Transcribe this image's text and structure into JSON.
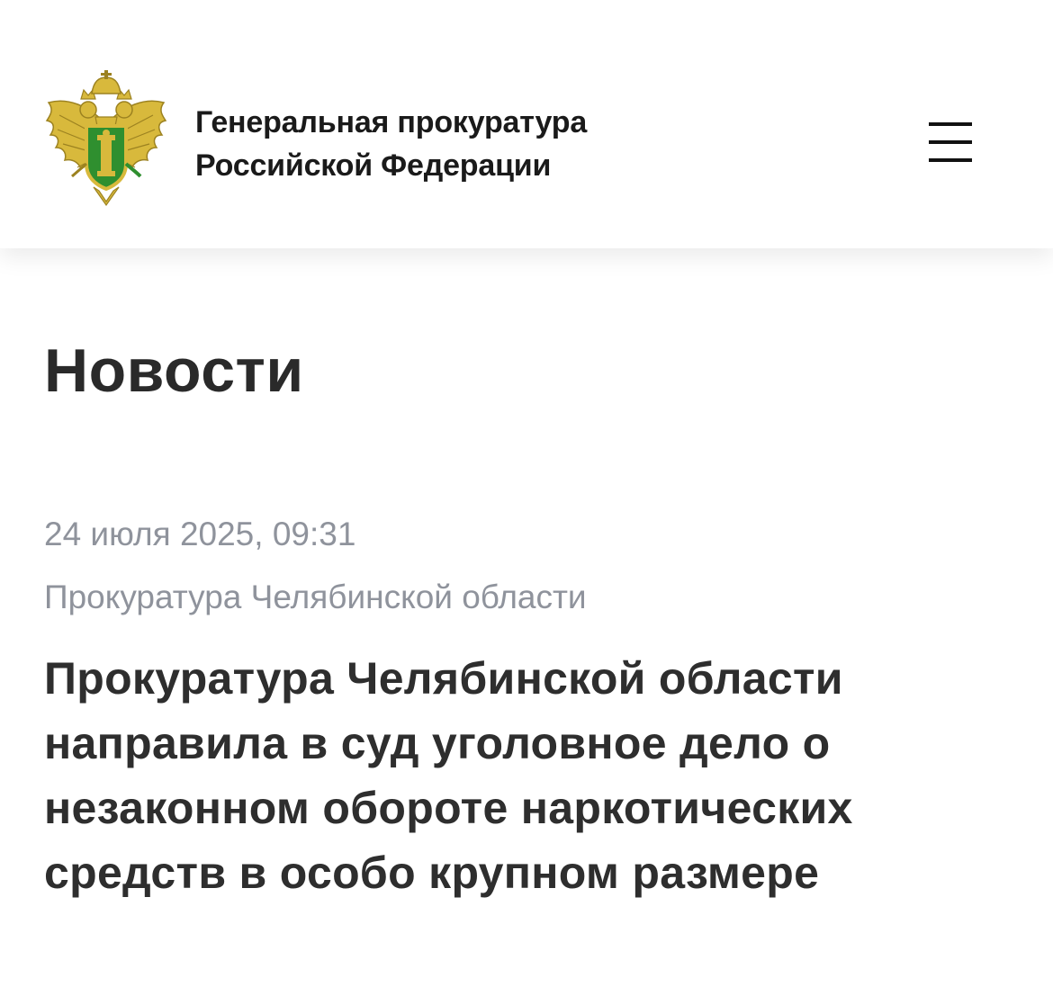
{
  "header": {
    "org_name_line1": "Генеральная прокуратура",
    "org_name_line2": "Российской Федерации",
    "emblem_icon": "prosecutor-emblem-icon",
    "menu_icon": "hamburger-menu-icon"
  },
  "page": {
    "title": "Новости"
  },
  "news": {
    "date": "24 июля 2025, 09:31",
    "source": "Прокуратура Челябинской области",
    "headline_lines": [
      "Прокуратура Челябинской области",
      "направила в суд уголовное дело о",
      "незаконном обороте наркотических",
      "средств в особо крупном размере"
    ]
  },
  "colors": {
    "text_dark": "#2e2e2e",
    "text_meta": "#8f939c",
    "emblem_gold": "#d8b93c",
    "emblem_green": "#2f8f2f"
  }
}
